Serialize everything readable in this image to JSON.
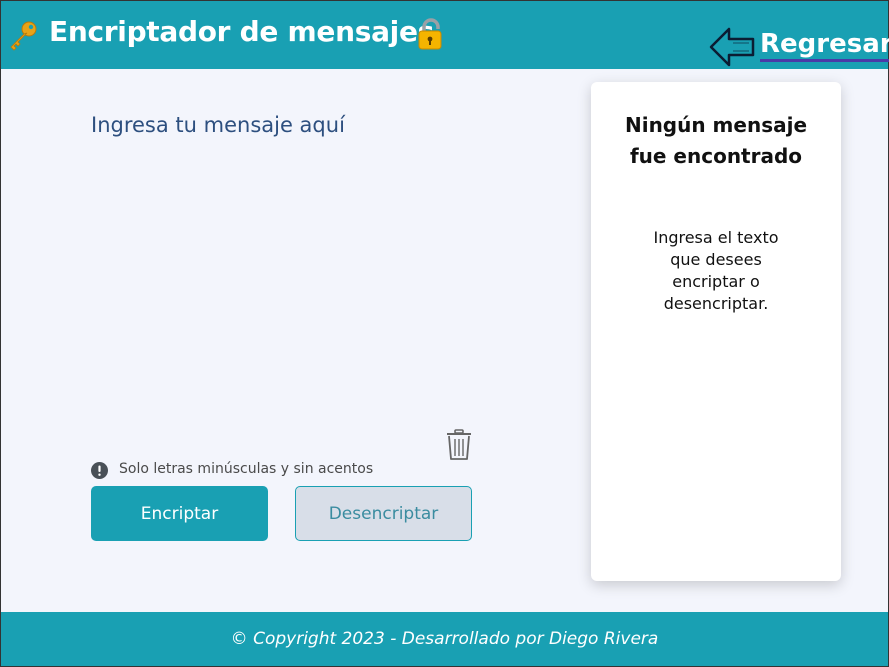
{
  "header": {
    "title": "Encriptador de mensajes",
    "back_label": "Regresar",
    "icons": [
      "key-icon",
      "lock-icon",
      "back-arrow-icon"
    ]
  },
  "editor": {
    "placeholder": "Ingresa tu mensaje aquí",
    "value": "",
    "hint": "Solo letras minúsculas y sin acentos"
  },
  "actions": {
    "encrypt_label": "Encriptar",
    "decrypt_label": "Desencriptar"
  },
  "result": {
    "title": "Ningún mensaje fue encontrado",
    "text": "Ingresa el texto que desees encriptar o desencriptar."
  },
  "footer": {
    "text": "© Copyright 2023 - Desarrollado por Diego Rivera"
  },
  "colors": {
    "accent": "#19a0b3",
    "background": "#f3f5fc",
    "placeholder_text": "#2d4f7f",
    "decrypt_button_bg": "#d8dee8"
  }
}
